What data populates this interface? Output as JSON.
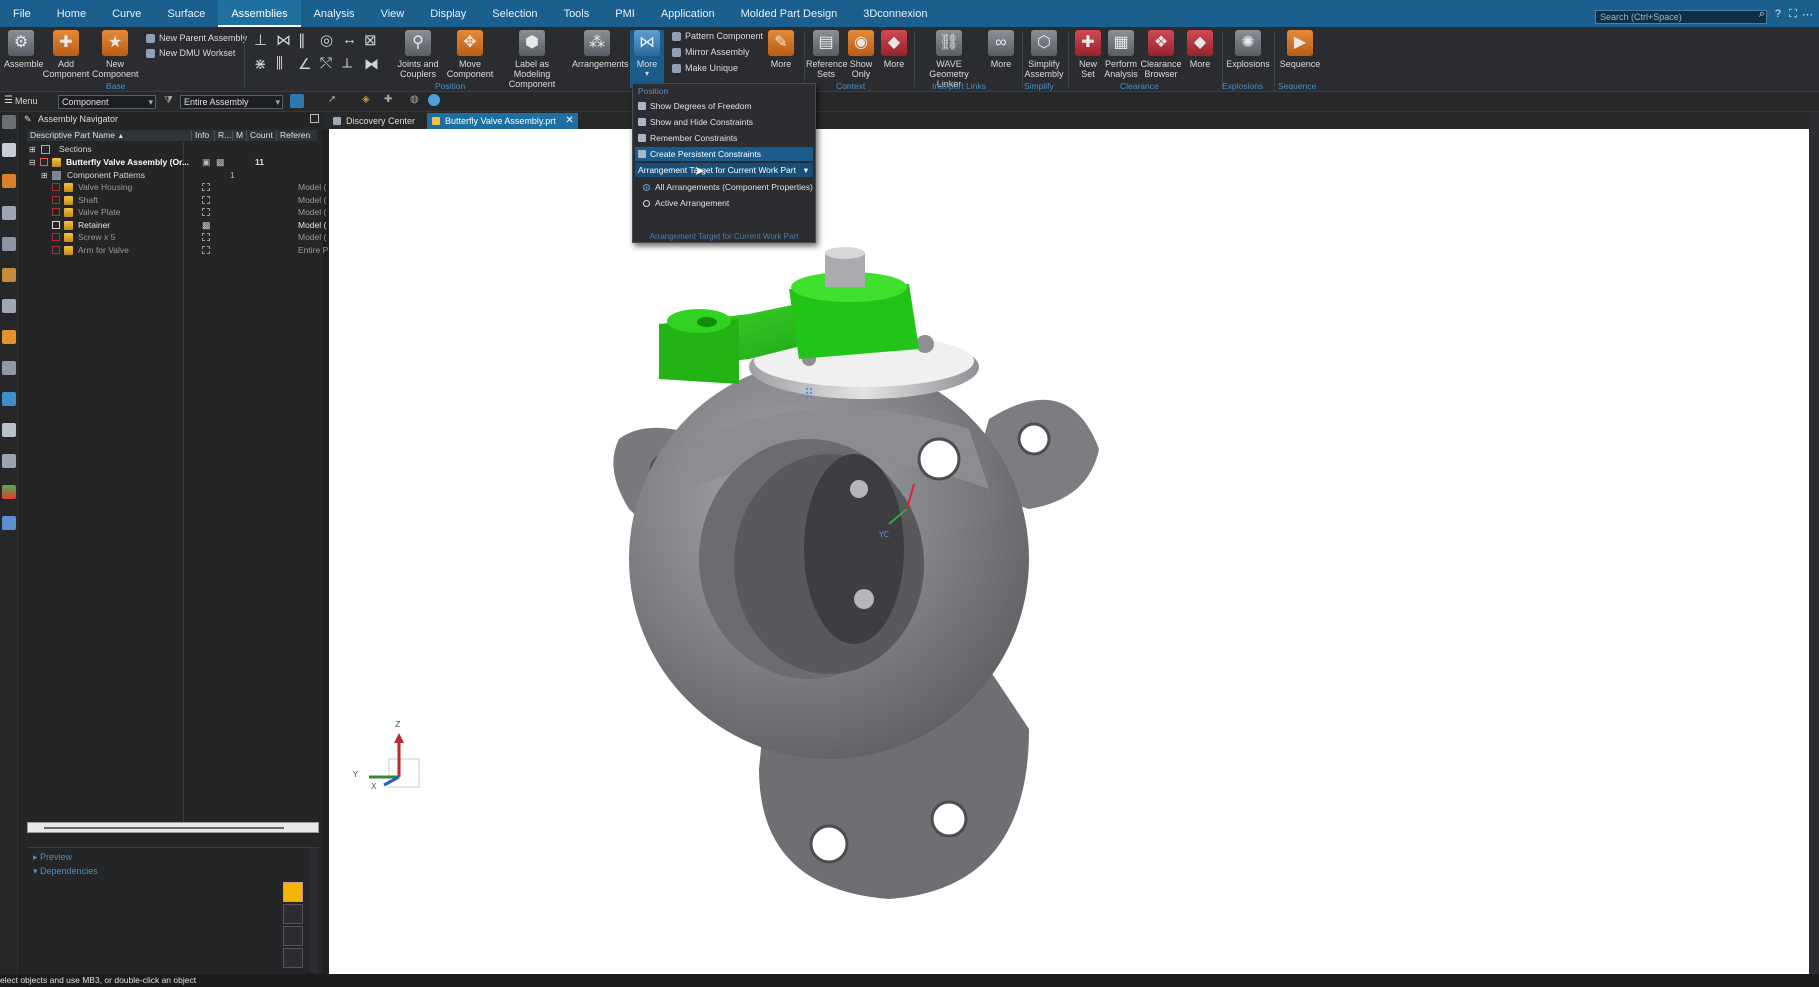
{
  "menubar": {
    "tabs": [
      "File",
      "Home",
      "Curve",
      "Surface",
      "Assemblies",
      "Analysis",
      "View",
      "Display",
      "Selection",
      "Tools",
      "PMI",
      "Application",
      "Molded Part Design",
      "3Dconnexion"
    ],
    "active_tab": "Assemblies",
    "search_placeholder": "Search (Ctrl+Space)"
  },
  "ribbon": {
    "assemble": "Assemble",
    "add_component": "Add Component",
    "new_component": "New Component",
    "new_parent_assembly": "New Parent Assembly",
    "new_dmu_workset": "New DMU Workset",
    "base_group": "Base",
    "joints_and_couplers": "Joints and Couplers",
    "move_component": "Move Component",
    "label_as_modeling_component": "Label as Modeling Component",
    "arrangements": "Arrangements",
    "more_1": "More",
    "pattern_component": "Pattern Component",
    "mirror_assembly": "Mirror Assembly",
    "make_unique": "Make Unique",
    "more_2": "More",
    "position_group": "Position",
    "reference_sets": "Reference Sets",
    "show_only": "Show Only",
    "more_3": "More",
    "context_group": "Context",
    "wave_geometry_linker": "WAVE Geometry Linker",
    "more_4": "More",
    "interpart_links_group": "Interpart Links",
    "simplify_assembly": "Simplify Assembly",
    "simplify_group": "Simplify",
    "new_set": "New Set",
    "perform_analysis": "Perform Analysis",
    "clearance_browser": "Clearance Browser",
    "more_5": "More",
    "clearance_group": "Clearance",
    "explosions": "Explosions",
    "explosions_group": "Explosions",
    "sequence": "Sequence",
    "sequence_group": "Sequence"
  },
  "cmdbar": {
    "menu_label": "Menu",
    "filter_value": "Component",
    "scope_value": "Entire Assembly"
  },
  "tabs": {
    "discovery_center": "Discovery Center",
    "active_doc": "Butterfly Valve Assembly.prt"
  },
  "navigator": {
    "title": "Assembly Navigator",
    "columns": [
      "Descriptive Part Name",
      "Info",
      "R...",
      "M",
      "Count",
      "Referen"
    ],
    "rows": [
      {
        "name": "Sections",
        "count": "",
        "ref": ""
      },
      {
        "name": "Butterfly Valve Assembly (Or...",
        "count": "11",
        "ref": ""
      },
      {
        "name": "Component Patterns",
        "count": "1",
        "ref": ""
      },
      {
        "name": "Valve Housing",
        "count": "",
        "ref": "Model ("
      },
      {
        "name": "Shaft",
        "count": "",
        "ref": "Model ("
      },
      {
        "name": "Valve Plate",
        "count": "",
        "ref": "Model ("
      },
      {
        "name": "Retainer",
        "count": "",
        "ref": "Model ("
      },
      {
        "name": "Screw x 5",
        "count": "",
        "ref": "Model ("
      },
      {
        "name": "Arm for Valve",
        "count": "",
        "ref": "Entire P"
      }
    ],
    "preview": "Preview",
    "dependencies": "Dependencies"
  },
  "dropdown": {
    "header": "Position",
    "items": [
      "Show Degrees of Freedom",
      "Show and Hide Constraints",
      "Remember Constraints",
      "Create Persistent Constraints"
    ],
    "highlighted_item": "Create Persistent Constraints",
    "submenu_label": "Arrangement Target for Current Work Part",
    "radio_options": [
      "All Arrangements (Component Properties)",
      "Active Arrangement"
    ],
    "radio_selected": "All Arrangements (Component Properties)",
    "footer": "Arrangement Target for Current Work Part"
  },
  "triad": {
    "x": "X",
    "y": "Y",
    "z": "Z",
    "mini": "YC"
  },
  "status": "elect objects and use MB3, or double-click an object",
  "colors": {
    "menubar_bg": "#1b5f8f",
    "accent": "#1d6fa3",
    "arm_green": "#2fbf1f",
    "housing_grey": "#7d7f83"
  }
}
